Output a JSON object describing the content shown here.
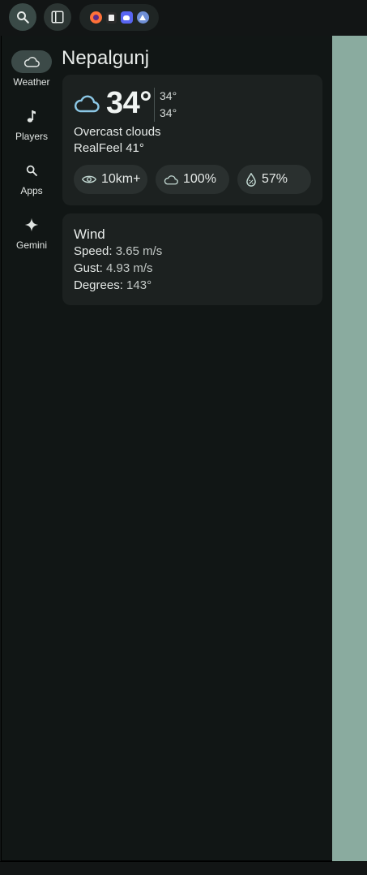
{
  "colors": {
    "accent_cloud": "#8cc8e6",
    "panel_bg": "#111615",
    "card_bg": "#1c2120",
    "active_nav_bg": "#3c4a48",
    "side_strip": "#8aab9f"
  },
  "topbar": {
    "search_icon": "search-icon",
    "sidebar_icon": "sidebar-toggle-icon",
    "pinned_apps": [
      "firefox-icon",
      "notes-app-icon",
      "discord-icon",
      "arch-linux-icon"
    ]
  },
  "nav": {
    "items": [
      {
        "label": "Weather",
        "icon": "cloud-icon",
        "active": true
      },
      {
        "label": "Players",
        "icon": "music-note-icon",
        "active": false
      },
      {
        "label": "Apps",
        "icon": "search-icon",
        "active": false
      },
      {
        "label": "Gemini",
        "icon": "sparkle-icon",
        "active": false
      }
    ]
  },
  "weather": {
    "city": "Nepalgunj",
    "temperature": "34°",
    "high": "34°",
    "low": "34°",
    "condition": "Overcast clouds",
    "realfeel": "RealFeel 41°",
    "stats": {
      "visibility": "10km+",
      "cloud_cover": "100%",
      "humidity": "57%"
    }
  },
  "wind": {
    "title": "Wind",
    "speed_label": "Speed:",
    "speed": "3.65 m/s",
    "gust_label": "Gust:",
    "gust": "4.93 m/s",
    "degrees_label": "Degrees:",
    "degrees": "143°"
  }
}
